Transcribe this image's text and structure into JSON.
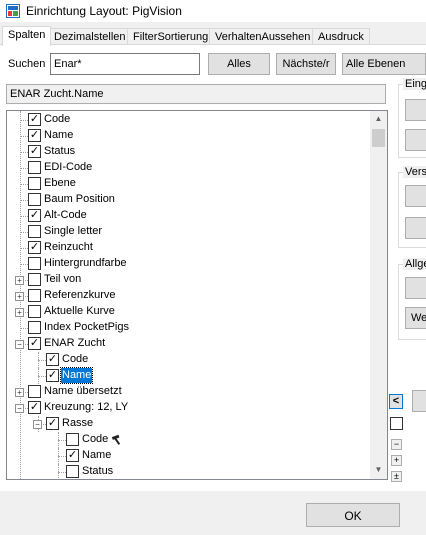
{
  "window": {
    "title": "Einrichtung Layout: PigVision",
    "icon": "pigvision-app-icon"
  },
  "tabs": [
    {
      "label": "Spalten",
      "active": true
    },
    {
      "label": "Dezimalstellen",
      "active": false
    },
    {
      "label": "FilterSortierung",
      "active": false
    },
    {
      "label": "VerhaltenAussehen",
      "active": false
    },
    {
      "label": "Ausdruck",
      "active": false
    }
  ],
  "search": {
    "label": "Suchen",
    "value": "Enar*",
    "all_button": "Alles",
    "next_button": "Nächste/r",
    "scope_select": "Alle Ebenen"
  },
  "selected_path": "ENAR Zucht.Name",
  "tree": {
    "nodes": [
      {
        "label": "Code",
        "checked": true,
        "level": 1,
        "expander": null
      },
      {
        "label": "Name",
        "checked": true,
        "level": 1,
        "expander": null
      },
      {
        "label": "Status",
        "checked": true,
        "level": 1,
        "expander": null
      },
      {
        "label": "EDI-Code",
        "checked": false,
        "level": 1,
        "expander": null
      },
      {
        "label": "Ebene",
        "checked": false,
        "level": 1,
        "expander": null
      },
      {
        "label": "Baum Position",
        "checked": false,
        "level": 1,
        "expander": null
      },
      {
        "label": "Alt-Code",
        "checked": true,
        "level": 1,
        "expander": null
      },
      {
        "label": "Single letter",
        "checked": false,
        "level": 1,
        "expander": null
      },
      {
        "label": "Reinzucht",
        "checked": true,
        "level": 1,
        "expander": null
      },
      {
        "label": "Hintergrundfarbe",
        "checked": false,
        "level": 1,
        "expander": null
      },
      {
        "label": "Teil von",
        "checked": false,
        "level": 1,
        "expander": "+"
      },
      {
        "label": "Referenzkurve",
        "checked": false,
        "level": 1,
        "expander": "+"
      },
      {
        "label": "Aktuelle Kurve",
        "checked": false,
        "level": 1,
        "expander": "+"
      },
      {
        "label": "Index PocketPigs",
        "checked": false,
        "level": 1,
        "expander": null
      },
      {
        "label": "ENAR Zucht",
        "checked": true,
        "level": 1,
        "expander": "-"
      },
      {
        "label": "Code",
        "checked": true,
        "level": 2,
        "expander": null
      },
      {
        "label": "Name",
        "checked": true,
        "level": 2,
        "expander": null,
        "selected": true
      },
      {
        "label": "Name übersetzt",
        "checked": false,
        "level": 1,
        "expander": "+"
      },
      {
        "label": "Kreuzung: 12, LY",
        "checked": true,
        "level": 1,
        "expander": "-"
      },
      {
        "label": "Rasse",
        "checked": true,
        "level": 2,
        "expander": "-"
      },
      {
        "label": "Code",
        "checked": false,
        "level": 3,
        "expander": null,
        "icon": "hammer-icon"
      },
      {
        "label": "Name",
        "checked": true,
        "level": 3,
        "expander": null
      },
      {
        "label": "Status",
        "checked": false,
        "level": 3,
        "expander": null
      }
    ]
  },
  "right_panel": {
    "group1_title": "Eing",
    "group2_title": "Vers",
    "group3_title": "Allge",
    "group3_button": "We",
    "arrow_left": "<",
    "collapse_all": "−",
    "expand_one": "+",
    "expand_all": "±"
  },
  "footer": {
    "ok_button": "OK"
  },
  "colors": {
    "selection": "#0078d7",
    "window_bg": "#f0f0f0"
  }
}
